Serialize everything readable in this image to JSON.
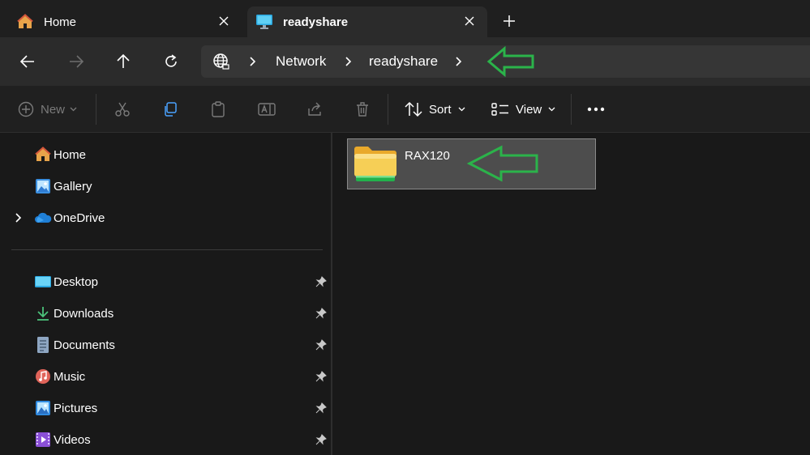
{
  "tabs": [
    {
      "label": "Home",
      "icon": "home-icon"
    },
    {
      "label": "readyshare",
      "icon": "monitor-icon"
    }
  ],
  "navigation": {
    "breadcrumbs": [
      "Network",
      "readyshare"
    ]
  },
  "toolbar": {
    "new_label": "New",
    "sort_label": "Sort",
    "view_label": "View"
  },
  "sidebar": {
    "top_items": [
      {
        "label": "Home",
        "icon": "home-icon"
      },
      {
        "label": "Gallery",
        "icon": "gallery-icon"
      },
      {
        "label": "OneDrive",
        "icon": "onedrive-icon"
      }
    ],
    "pinned_items": [
      {
        "label": "Desktop",
        "icon": "desktop-icon"
      },
      {
        "label": "Downloads",
        "icon": "download-icon"
      },
      {
        "label": "Documents",
        "icon": "documents-icon"
      },
      {
        "label": "Music",
        "icon": "music-icon"
      },
      {
        "label": "Pictures",
        "icon": "pictures-icon"
      },
      {
        "label": "Videos",
        "icon": "videos-icon"
      }
    ]
  },
  "content": {
    "items": [
      {
        "name": "RAX120",
        "type": "network-share-folder"
      }
    ]
  },
  "colors": {
    "annotation_arrow": "#2bb34a",
    "folder_yellow": "#f6c94a",
    "folder_green_strip": "#22b14c"
  }
}
